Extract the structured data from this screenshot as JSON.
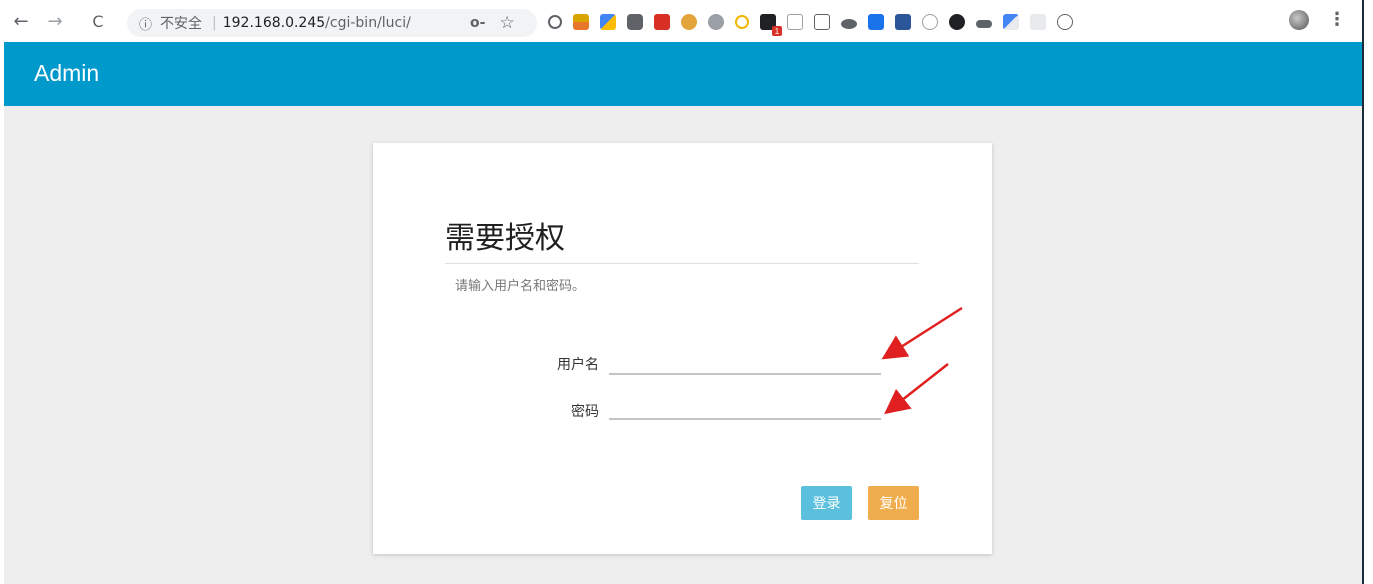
{
  "browser": {
    "back_icon": "←",
    "forward_icon": "→",
    "reload_icon": "C",
    "info_icon": "ⓘ",
    "insecure_label": "不安全",
    "separator": "|",
    "url_host": "192.168.0.245",
    "url_path": "/cgi-bin/luci/",
    "key_icon": "o-",
    "star_icon": "☆",
    "menu_icon": "⋮",
    "extension_badge": "1"
  },
  "header": {
    "brand": "Admin",
    "color": "#0099cc"
  },
  "login": {
    "title": "需要授权",
    "description": "请输入用户名和密码。",
    "username_label": "用户名",
    "username_value": "",
    "password_label": "密码",
    "password_value": "",
    "login_button": "登录",
    "reset_button": "复位",
    "login_color": "#5bc0de",
    "reset_color": "#f0ad4e"
  },
  "annotations": {
    "arrow_color": "#e02020"
  }
}
